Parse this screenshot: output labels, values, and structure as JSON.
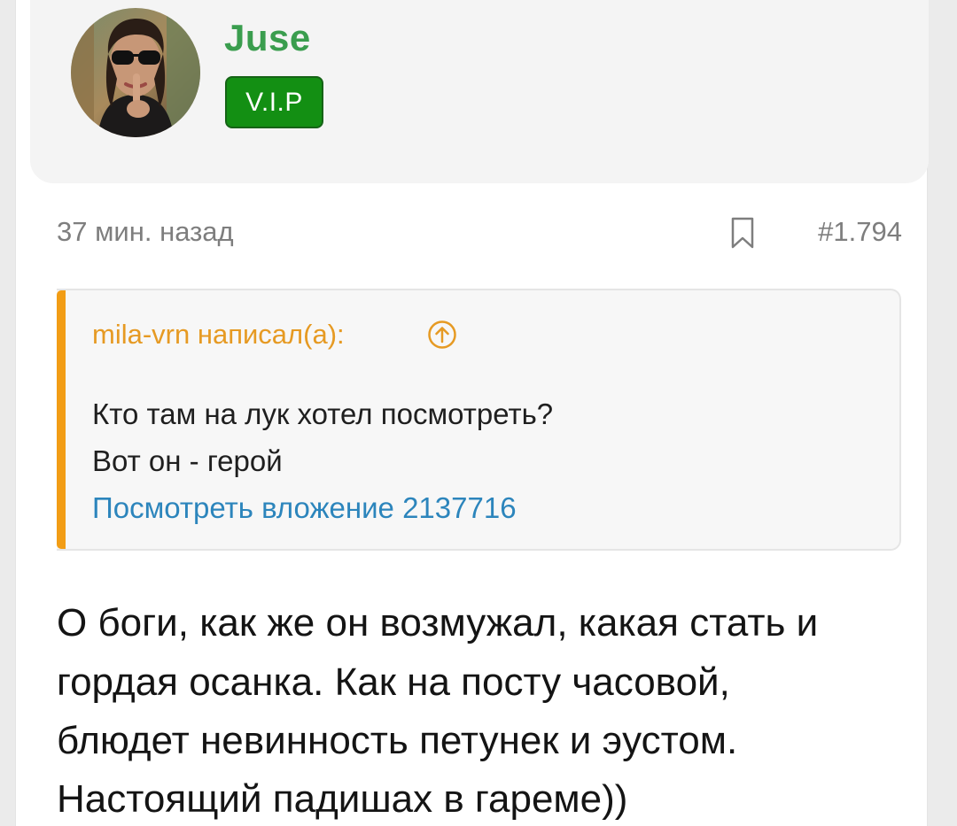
{
  "author": {
    "name": "Juse",
    "badge": "V.I.P",
    "accent_color": "#3a9d4e",
    "badge_color": "#138f13"
  },
  "meta": {
    "time": "37 мин. назад",
    "post_number": "#1.794",
    "bookmark_icon": "bookmark-icon"
  },
  "quote": {
    "author": "mila-vrn написал(а):",
    "goto_icon": "arrow-up-circle-icon",
    "lines": [
      "Кто там на лук хотел посмотреть?",
      "Вот он - герой"
    ],
    "attachment_link": "Посмотреть вложение 2137716",
    "bar_color": "#f29d15",
    "link_color": "#2c85bc"
  },
  "message": {
    "lines": [
      "О боги, как же он возмужал, какая стать и",
      "гордая осанка. Как на посту часовой,",
      "блюдет невинность петунек и эустом.",
      "Настоящий падишах в гареме))"
    ]
  }
}
